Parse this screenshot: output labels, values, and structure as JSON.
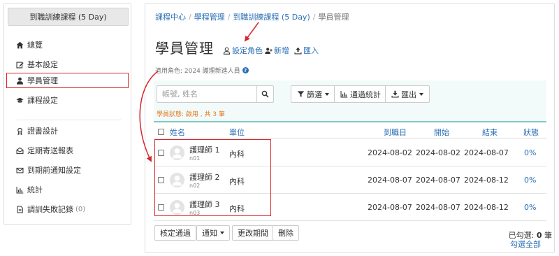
{
  "sidebar": {
    "course_button": "到職訓練課程 (5 Day)",
    "items": [
      {
        "label": "總覽",
        "icon": "home-icon"
      },
      {
        "label": "基本設定",
        "icon": "edit-icon"
      },
      {
        "label": "學員管理",
        "icon": "user-icon",
        "active": true
      },
      {
        "label": "課程設定",
        "icon": "graduation-cap-icon"
      },
      {
        "label": "證書設計",
        "icon": "certificate-icon"
      },
      {
        "label": "定期寄送報表",
        "icon": "envelope-open-icon"
      },
      {
        "label": "到期前通知設定",
        "icon": "envelope-icon"
      },
      {
        "label": "統計",
        "icon": "bar-chart-icon"
      },
      {
        "label": "調訓失敗記錄",
        "icon": "file-icon",
        "count": "(0)"
      }
    ]
  },
  "breadcrumb": {
    "items": [
      "課程中心",
      "學程管理",
      "到職訓練課程 (5 Day)"
    ],
    "current": "學員管理"
  },
  "page": {
    "title": "學員管理",
    "actions": {
      "set_role": "設定角色",
      "add": "新增",
      "import": "匯入"
    },
    "role_line": "適用角色: 2024 護理新進人員"
  },
  "toolbar": {
    "search_placeholder": "帳號, 姓名",
    "filter": "篩選",
    "stats": "通過統計",
    "export": "匯出"
  },
  "status_line": "學員狀態: 啟用 , 共 3 筆",
  "table": {
    "headers": {
      "name": "姓名",
      "unit": "單位",
      "arrival": "到職日",
      "start": "開始",
      "end": "結束",
      "status": "狀態"
    },
    "rows": [
      {
        "name": "護理師 1",
        "account": "n01",
        "unit": "內科",
        "arrival": "2024-08-02",
        "start": "2024-08-02",
        "end": "2024-08-07",
        "status": "0%"
      },
      {
        "name": "護理師 2",
        "account": "n02",
        "unit": "內科",
        "arrival": "2024-08-07",
        "start": "2024-08-07",
        "end": "2024-08-12",
        "status": "0%"
      },
      {
        "name": "護理師 3",
        "account": "n03",
        "unit": "內科",
        "arrival": "2024-08-07",
        "start": "2024-08-07",
        "end": "2024-08-12",
        "status": "0%"
      }
    ]
  },
  "footer": {
    "approve": "核定通過",
    "notify": "通知",
    "change_period": "更改期間",
    "delete": "刪除",
    "selected_label": "已勾選: ",
    "selected_count": "0",
    "selected_unit": " 筆",
    "select_all": "勾選全部"
  },
  "colors": {
    "link": "#2a6fb5",
    "annotation": "#d9262b",
    "status_orange": "#e07a1f",
    "panel_bg": "#f3fbfa",
    "panel_border": "#7dc9bc"
  }
}
